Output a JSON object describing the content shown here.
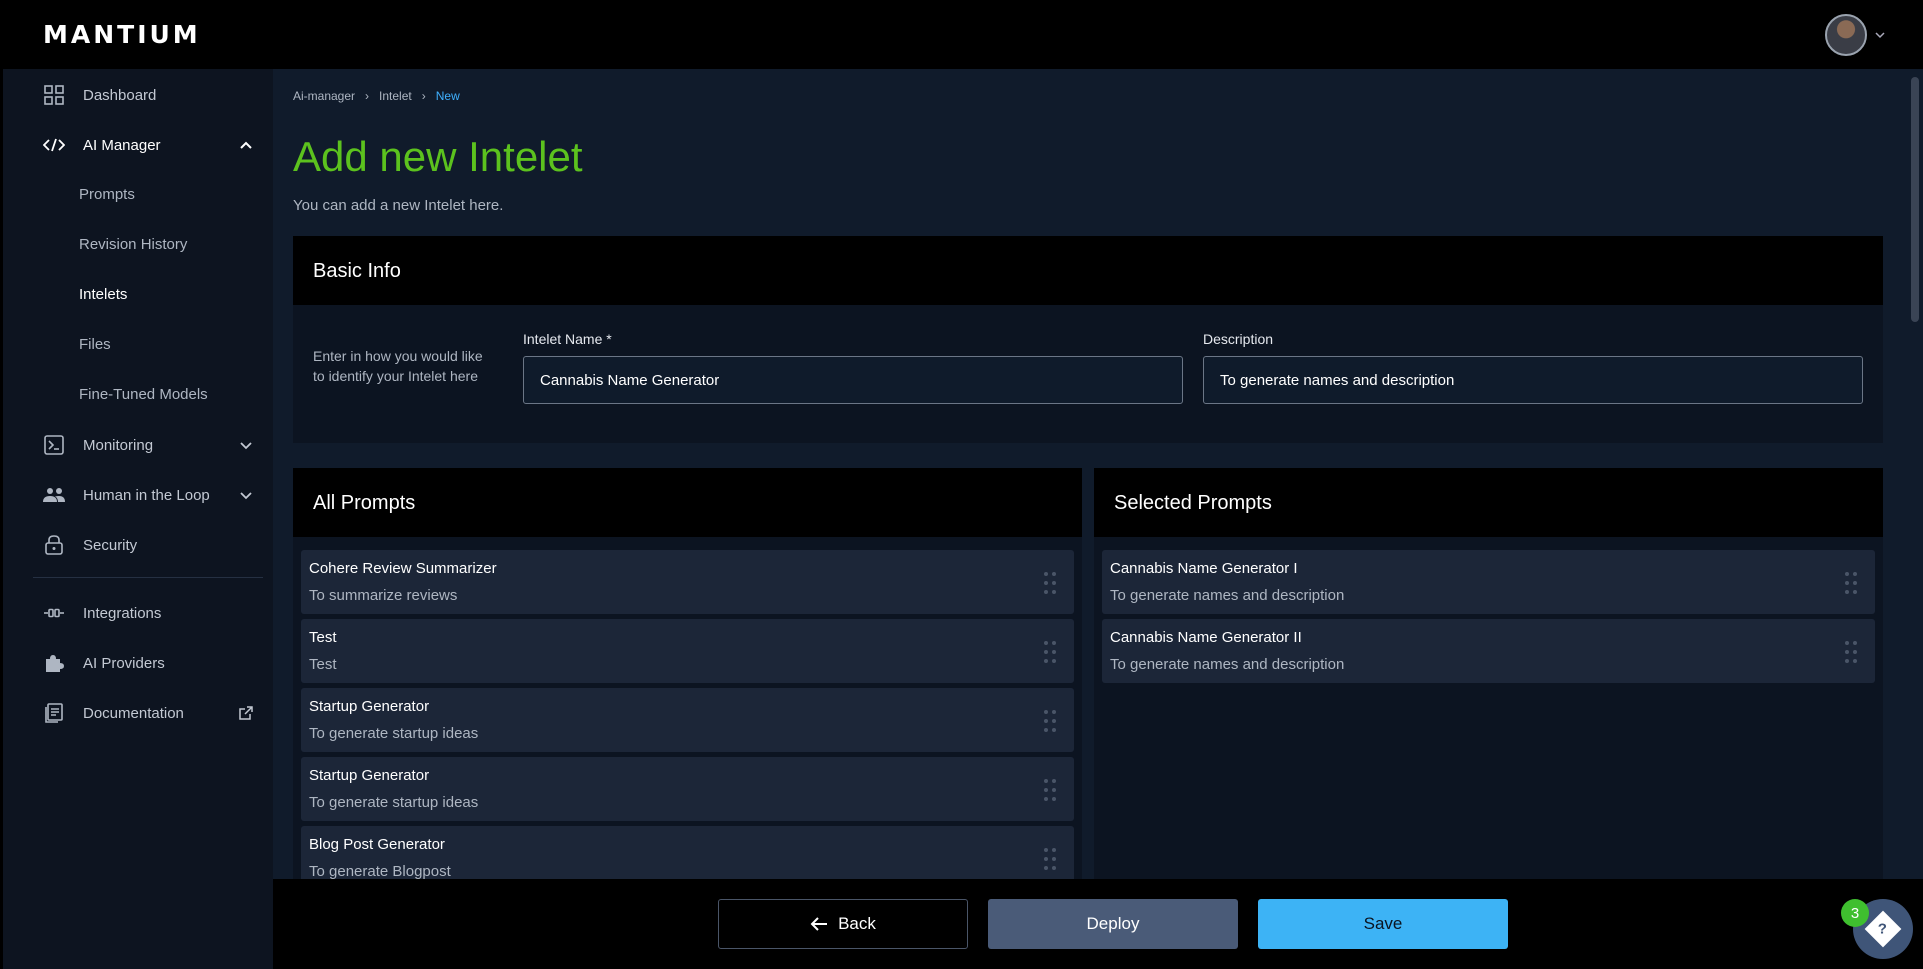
{
  "app": {
    "logo": "MANTIUM"
  },
  "sidebar": {
    "items": [
      {
        "label": "Dashboard",
        "icon": "grid-icon"
      },
      {
        "label": "AI Manager",
        "icon": "code-icon",
        "expanded": true,
        "children": [
          "Prompts",
          "Revision History",
          "Intelets",
          "Files",
          "Fine-Tuned Models"
        ],
        "active_child": "Intelets"
      },
      {
        "label": "Monitoring",
        "icon": "terminal-icon"
      },
      {
        "label": "Human in the Loop",
        "icon": "people-icon"
      },
      {
        "label": "Security",
        "icon": "lock-icon"
      },
      {
        "label": "Integrations",
        "icon": "integration-icon"
      },
      {
        "label": "AI Providers",
        "icon": "puzzle-icon"
      },
      {
        "label": "Documentation",
        "icon": "document-icon"
      }
    ]
  },
  "breadcrumb": [
    "Ai-manager",
    "Intelet",
    "New"
  ],
  "page": {
    "title": "Add new Intelet",
    "subtitle": "You can add a new Intelet here."
  },
  "basic_info": {
    "title": "Basic Info",
    "help": "Enter in how you would like to identify your Intelet here",
    "name_label": "Intelet Name *",
    "name_value": "Cannabis Name Generator",
    "description_label": "Description",
    "description_value": "To generate names and description"
  },
  "all_prompts": {
    "title": "All Prompts",
    "items": [
      {
        "name": "Cohere Review Summarizer",
        "desc": "To summarize reviews"
      },
      {
        "name": "Test",
        "desc": "Test"
      },
      {
        "name": "Startup Generator",
        "desc": "To generate startup ideas"
      },
      {
        "name": "Startup Generator",
        "desc": "To generate startup ideas"
      },
      {
        "name": "Blog Post Generator",
        "desc": "To generate Blogpost"
      }
    ]
  },
  "selected_prompts": {
    "title": "Selected Prompts",
    "items": [
      {
        "name": "Cannabis Name Generator I",
        "desc": "To generate names and description"
      },
      {
        "name": "Cannabis Name Generator II",
        "desc": "To generate names and description"
      }
    ]
  },
  "footer": {
    "back": "Back",
    "deploy": "Deploy",
    "save": "Save"
  },
  "help": {
    "badge_count": "3"
  },
  "colors": {
    "accent_green": "#5cc21e",
    "accent_blue": "#3db3f5",
    "link_blue": "#3fb1ff"
  }
}
